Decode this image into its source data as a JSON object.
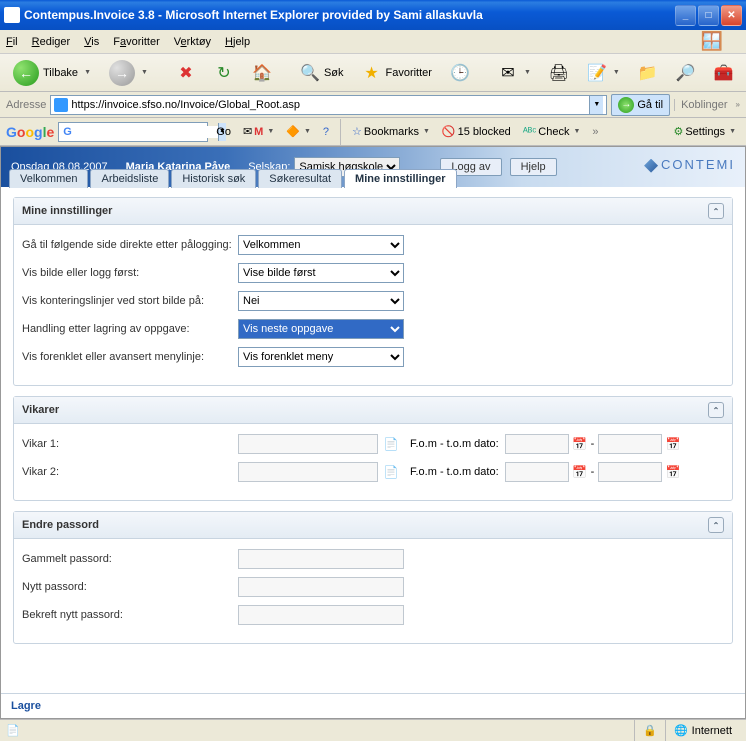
{
  "window": {
    "title": "Contempus.Invoice 3.8 - Microsoft Internet Explorer provided by Sami allaskuvla"
  },
  "menubar": {
    "file": "Fil",
    "edit": "Rediger",
    "view": "Vis",
    "favorites": "Favoritter",
    "tools": "Verktøy",
    "help": "Hjelp"
  },
  "toolbar": {
    "back": "Tilbake",
    "search": "Søk",
    "favorites": "Favoritter"
  },
  "addressbar": {
    "label": "Adresse",
    "url": "https://invoice.sfso.no/Invoice/Global_Root.asp",
    "go": "Gå til",
    "links": "Koblinger"
  },
  "googlebar": {
    "go": "Go",
    "bookmarks": "Bookmarks",
    "blocked": "15 blocked",
    "check": "Check",
    "settings": "Settings"
  },
  "app": {
    "date": "Onsdag 08.08.2007",
    "user": "Marja Katarina Påve",
    "company_label": "Selskap:",
    "company": "Samisk høgskole",
    "logoff": "Logg av",
    "help": "Hjelp",
    "brand": "CONTEMI",
    "tabs": [
      "Velkommen",
      "Arbeidsliste",
      "Historisk søk",
      "Søkeresultat",
      "Mine innstillinger"
    ]
  },
  "settings": {
    "title": "Mine innstillinger",
    "rows": {
      "landing": {
        "label": "Gå til følgende side direkte etter pålogging:",
        "value": "Velkommen"
      },
      "showfirst": {
        "label": "Vis bilde eller logg først:",
        "value": "Vise bilde først"
      },
      "lines": {
        "label": "Vis konteringslinjer ved stort bilde på:",
        "value": "Nei"
      },
      "aftersave": {
        "label": "Handling etter lagring av oppgave:",
        "value": "Vis neste oppgave"
      },
      "menustyle": {
        "label": "Vis forenklet eller avansert menylinje:",
        "value": "Vis forenklet meny"
      }
    }
  },
  "vikarer": {
    "title": "Vikarer",
    "vikar1": "Vikar 1:",
    "vikar2": "Vikar 2:",
    "daterange": "F.o.m - t.o.m dato:",
    "dash": "-"
  },
  "password": {
    "title": "Endre passord",
    "old": "Gammelt passord:",
    "new": "Nytt passord:",
    "confirm": "Bekreft nytt passord:"
  },
  "footer": {
    "save": "Lagre"
  },
  "statusbar": {
    "zone": "Internett"
  }
}
